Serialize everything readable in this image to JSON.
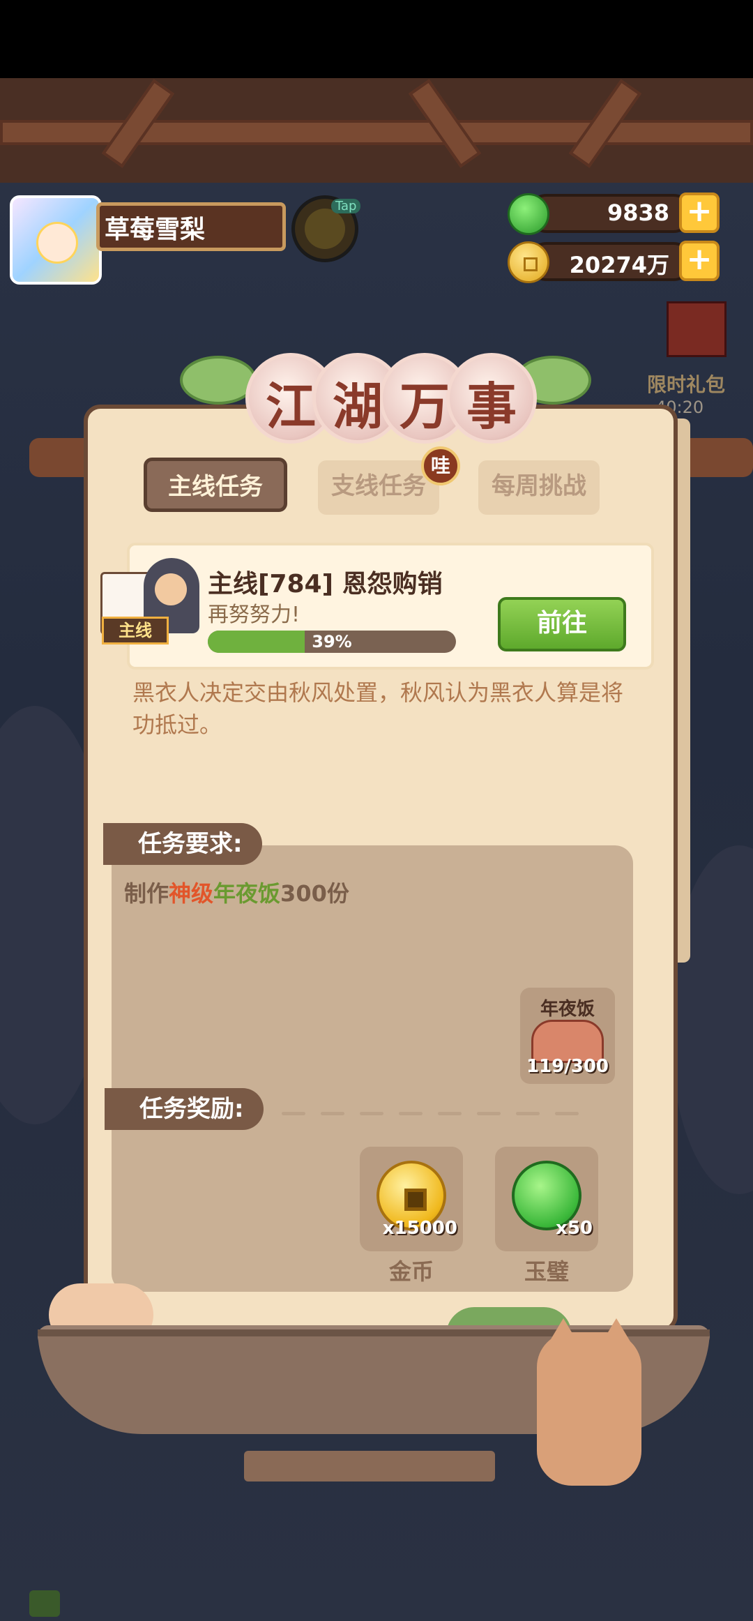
{
  "player": {
    "name": "草莓雪梨"
  },
  "hud": {
    "tap_label": "Tap",
    "jade_amount": "9838",
    "gold_amount": "20274万",
    "plus_symbol": "+"
  },
  "event": {
    "label": "限时礼包",
    "timer": "40:20"
  },
  "panel": {
    "title_chars": [
      "江",
      "湖",
      "万",
      "事"
    ]
  },
  "tabs": [
    {
      "label": "主线任务",
      "active": true
    },
    {
      "label": "支线任务",
      "active": false,
      "badge": "哇"
    },
    {
      "label": "每周挑战",
      "active": false
    }
  ],
  "quest": {
    "tag": "主线",
    "title": "主线[784] 恩怨购销",
    "subtitle": "再努努力!",
    "progress_percent": 39,
    "progress_text": "39%",
    "go_button": "前往",
    "description": "黑衣人决定交由秋风处置，秋风认为黑衣人算是将功抵过。"
  },
  "requirement": {
    "heading": "任务要求:",
    "text_parts": [
      "制作",
      "神级",
      "年夜饭",
      "300份"
    ],
    "item_name": "年夜饭",
    "item_count": "119/300"
  },
  "rewards": {
    "heading": "任务奖励:",
    "items": [
      {
        "name": "金币",
        "amount": "x15000",
        "icon": "gold-coin-icon"
      },
      {
        "name": "玉璧",
        "amount": "x50",
        "icon": "jade-disc-icon"
      }
    ]
  },
  "colors": {
    "accent_red": "#e2552a",
    "accent_green": "#6a9a30",
    "go_button": "#6fb13e"
  }
}
